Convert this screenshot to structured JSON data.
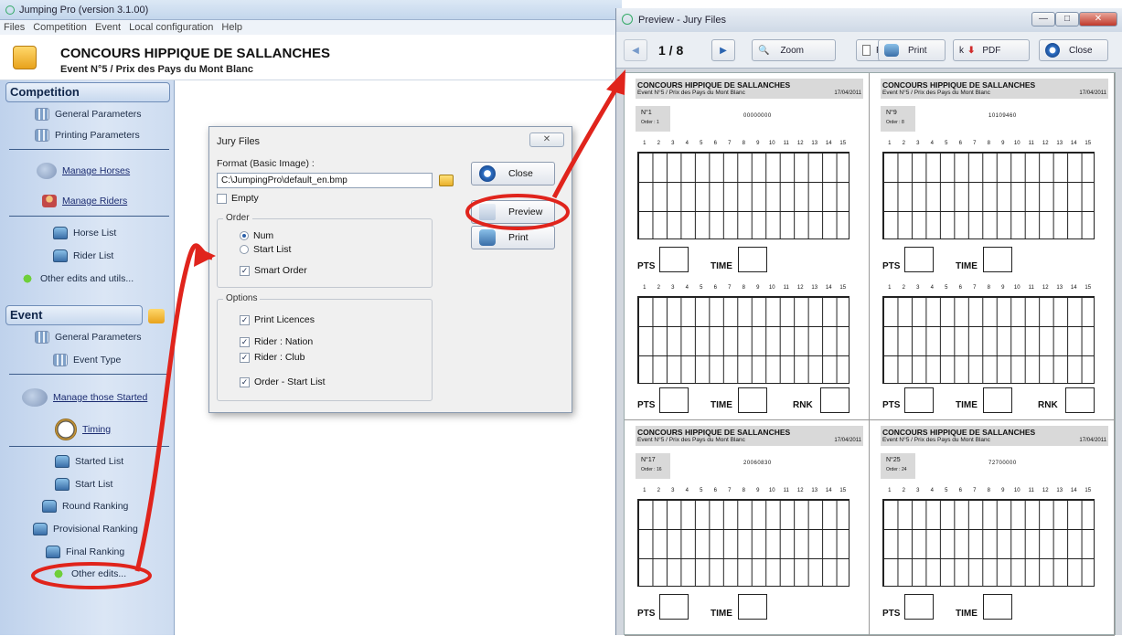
{
  "main_window": {
    "title": "Jumping Pro (version 3.1.00)",
    "menu": [
      "Files",
      "Competition",
      "Event",
      "Local configuration",
      "Help"
    ],
    "header_title": "CONCOURS HIPPIQUE DE SALLANCHES",
    "header_subtitle": "Event N°5 / Prix des Pays du Mont Blanc"
  },
  "sidebar": {
    "competition_label": "Competition",
    "competition_items": {
      "general_parameters": "General Parameters",
      "printing_parameters": "Printing Parameters",
      "manage_horses": "Manage Horses",
      "manage_riders": "Manage Riders",
      "horse_list": "Horse List",
      "rider_list": "Rider List",
      "other_edits_utils": "Other edits and utils..."
    },
    "event_label": "Event",
    "event_items": {
      "general_parameters": "General Parameters",
      "event_type": "Event Type",
      "manage_started": "Manage those Started",
      "timing": "Timing",
      "started_list": "Started List",
      "start_list": "Start List",
      "round_ranking": "Round Ranking",
      "provisional_ranking": "Provisional Ranking",
      "final_ranking": "Final Ranking",
      "other_edits": "Other edits..."
    }
  },
  "dialog": {
    "title": "Jury Files",
    "close_x": "✕",
    "format_label": "Format (Basic Image) :",
    "format_value": "C:\\JumpingPro\\default_en.bmp",
    "empty_label": "Empty",
    "order_group": "Order",
    "order_num": "Num",
    "order_start_list": "Start List",
    "smart_order": "Smart Order",
    "options_group": "Options",
    "print_licences": "Print Licences",
    "rider_nation": "Rider : Nation",
    "rider_club": "Rider : Club",
    "order_start_list_opt": "Order - Start List",
    "close_button": "Close",
    "preview_button": "Preview",
    "print_button": "Print"
  },
  "preview": {
    "title": "Preview - Jury Files",
    "page_indicator": "1 / 8",
    "zoom_label": "Zoom",
    "pc_label": "Pc",
    "print_label": "Print",
    "k_label": "k",
    "pdf_label": "PDF",
    "close_label": "Close",
    "sheet_title": "CONCOURS HIPPIQUE DE SALLANCHES",
    "sheet_subtitle": "Event N°5 / Prix des Pays du Mont Blanc",
    "sheet_date": "17/04/2011",
    "pts_label": "PTS",
    "time_label": "TIME",
    "rnk_label": "RNK",
    "columns": [
      "1",
      "2",
      "3",
      "4",
      "5",
      "6",
      "7",
      "8",
      "9",
      "10",
      "11",
      "12",
      "13",
      "14",
      "15"
    ],
    "sheets": [
      {
        "number": "N°1",
        "order": "Order : 1",
        "code": "00000000"
      },
      {
        "number": "N°9",
        "order": "Order : 8",
        "code": "10109460"
      },
      {
        "number": "N°17",
        "order": "Order : 16",
        "code": "20060830"
      },
      {
        "number": "N°25",
        "order": "Order : 24",
        "code": "72700000"
      }
    ]
  }
}
